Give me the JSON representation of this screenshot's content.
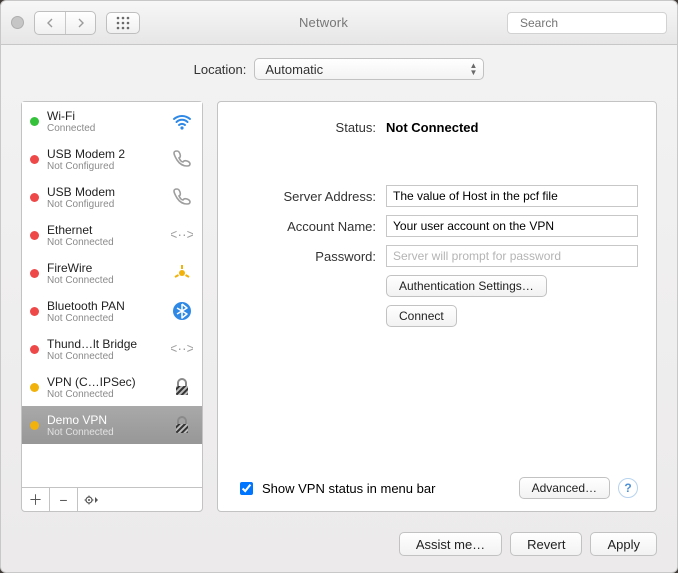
{
  "window": {
    "title": "Network",
    "search_placeholder": "Search"
  },
  "location": {
    "label": "Location:",
    "value": "Automatic"
  },
  "services": [
    {
      "name": "Wi-Fi",
      "status": "Connected",
      "dot": "green",
      "icon": "wifi"
    },
    {
      "name": "USB Modem 2",
      "status": "Not Configured",
      "dot": "red",
      "icon": "phone"
    },
    {
      "name": "USB Modem",
      "status": "Not Configured",
      "dot": "red",
      "icon": "phone"
    },
    {
      "name": "Ethernet",
      "status": "Not Connected",
      "dot": "red",
      "icon": "ethernet"
    },
    {
      "name": "FireWire",
      "status": "Not Connected",
      "dot": "red",
      "icon": "firewire"
    },
    {
      "name": "Bluetooth PAN",
      "status": "Not Connected",
      "dot": "red",
      "icon": "bluetooth"
    },
    {
      "name": "Thund…lt Bridge",
      "status": "Not Connected",
      "dot": "red",
      "icon": "ethernet"
    },
    {
      "name": "VPN (C…IPSec)",
      "status": "Not Connected",
      "dot": "yellow",
      "icon": "lock"
    },
    {
      "name": "Demo VPN",
      "status": "Not Connected",
      "dot": "yellow",
      "icon": "lock",
      "selected": true
    }
  ],
  "detail": {
    "status_label": "Status:",
    "status_value": "Not Connected",
    "fields": {
      "server_label": "Server Address:",
      "server_value": "The value of Host in the pcf file",
      "account_label": "Account Name:",
      "account_value": "Your user account on the VPN",
      "password_label": "Password:",
      "password_placeholder": "Server will prompt for password"
    },
    "auth_button": "Authentication Settings…",
    "connect_button": "Connect",
    "menubar_checkbox_label": "Show VPN status in menu bar",
    "menubar_checked": true,
    "advanced_button": "Advanced…"
  },
  "buttons": {
    "assist": "Assist me…",
    "revert": "Revert",
    "apply": "Apply"
  }
}
